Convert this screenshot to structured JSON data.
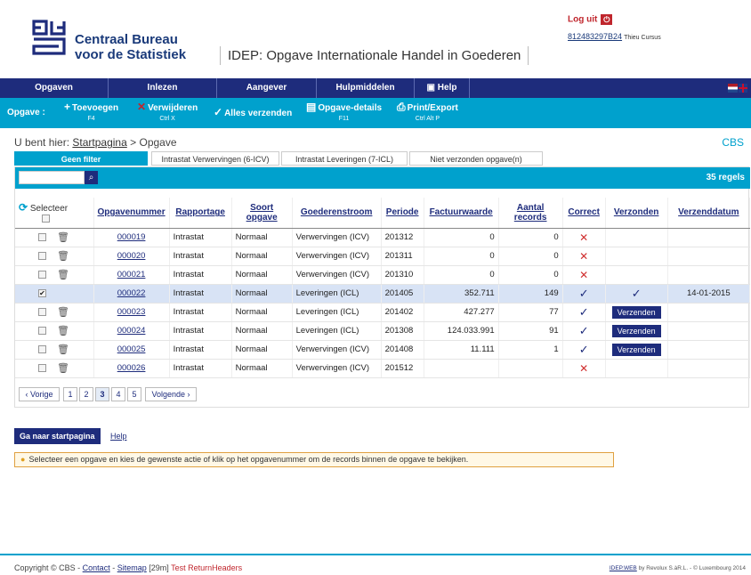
{
  "brand": {
    "line1": "Centraal Bureau",
    "line2": "voor de Statistiek",
    "app_title": "IDEP: Opgave Internationale Handel in Goederen"
  },
  "user": {
    "logout": "Log uit",
    "id": "812483297B24",
    "name": "Thieu Cursus"
  },
  "nav": [
    "Opgaven",
    "Inlezen",
    "Aangever",
    "Hulpmiddelen",
    "Help"
  ],
  "toolbar": {
    "label": "Opgave :",
    "buttons": [
      {
        "label": "Toevoegen",
        "key": "F4"
      },
      {
        "label": "Verwijderen",
        "key": "Ctrl X"
      },
      {
        "label": "Alles verzenden",
        "key": ""
      },
      {
        "label": "Opgave-details",
        "key": "F11"
      },
      {
        "label": "Print/Export",
        "key": "Ctrl Alt P"
      }
    ]
  },
  "breadcrumb": {
    "prefix": "U bent hier:",
    "home": "Startpagina",
    "sep": ">",
    "current": "Opgave",
    "right": "CBS"
  },
  "filters": [
    "Geen filter",
    "Intrastat Verwervingen (6-ICV)",
    "Intrastat Leveringen (7-ICL)",
    "Niet verzonden opgave(n)"
  ],
  "search": {
    "value": "",
    "count": "35 regels"
  },
  "columns": {
    "select": "Selecteer",
    "nummer": "Opgavenummer",
    "rapportage": "Rapportage",
    "soort": "Soort opgave",
    "stroom": "Goederenstroom",
    "periode": "Periode",
    "factuur": "Factuurwaarde",
    "records": "Aantal records",
    "correct": "Correct",
    "verzonden": "Verzonden",
    "datum": "Verzenddatum"
  },
  "rows": [
    {
      "nummer": "000019",
      "rapportage": "Intrastat",
      "soort": "Normaal",
      "stroom": "Verwervingen (ICV)",
      "periode": "201312",
      "factuur": "0",
      "records": "0",
      "correct": "✕",
      "verzonden": "",
      "datum": ""
    },
    {
      "nummer": "000020",
      "rapportage": "Intrastat",
      "soort": "Normaal",
      "stroom": "Verwervingen (ICV)",
      "periode": "201311",
      "factuur": "0",
      "records": "0",
      "correct": "✕",
      "verzonden": "",
      "datum": ""
    },
    {
      "nummer": "000021",
      "rapportage": "Intrastat",
      "soort": "Normaal",
      "stroom": "Verwervingen (ICV)",
      "periode": "201310",
      "factuur": "0",
      "records": "0",
      "correct": "✕",
      "verzonden": "",
      "datum": ""
    },
    {
      "nummer": "000022",
      "rapportage": "Intrastat",
      "soort": "Normaal",
      "stroom": "Leveringen (ICL)",
      "periode": "201405",
      "factuur": "352.711",
      "records": "149",
      "correct": "✓",
      "verzonden": "✓",
      "datum": "14-01-2015"
    },
    {
      "nummer": "000023",
      "rapportage": "Intrastat",
      "soort": "Normaal",
      "stroom": "Leveringen (ICL)",
      "periode": "201402",
      "factuur": "427.277",
      "records": "77",
      "correct": "✓",
      "verzonden": "Verzenden",
      "datum": ""
    },
    {
      "nummer": "000024",
      "rapportage": "Intrastat",
      "soort": "Normaal",
      "stroom": "Leveringen (ICL)",
      "periode": "201308",
      "factuur": "124.033.991",
      "records": "91",
      "correct": "✓",
      "verzonden": "Verzenden",
      "datum": ""
    },
    {
      "nummer": "000025",
      "rapportage": "Intrastat",
      "soort": "Normaal",
      "stroom": "Verwervingen (ICV)",
      "periode": "201408",
      "factuur": "11.111",
      "records": "1",
      "correct": "✓",
      "verzonden": "Verzenden",
      "datum": ""
    },
    {
      "nummer": "000026",
      "rapportage": "Intrastat",
      "soort": "Normaal",
      "stroom": "Verwervingen (ICV)",
      "periode": "201512",
      "factuur": "",
      "records": "",
      "correct": "✕",
      "verzonden": "",
      "datum": ""
    }
  ],
  "pager": {
    "prev": "‹ Vorige",
    "pages": [
      "1",
      "2",
      "3",
      "4",
      "5"
    ],
    "current": "3",
    "next": "Volgende ›"
  },
  "bottom": {
    "home_button": "Ga naar startpagina",
    "help": "Help",
    "hint": "Selecteer een opgave en kies de gewenste actie of klik op het opgavenummer om de records binnen de opgave te bekijken."
  },
  "footer": {
    "copyright": "Copyright © CBS -",
    "contact": "Contact",
    "sitemap": "Sitemap",
    "time": "[29m]",
    "test": "Test ReturnHeaders",
    "right_link": "IDEP.WEB",
    "right_text": "by Revolux S.àR.L. - © Luxembourg 2014"
  }
}
